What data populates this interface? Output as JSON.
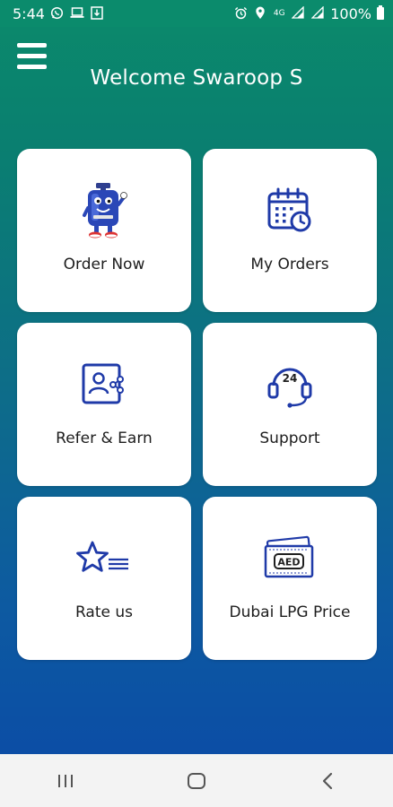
{
  "status_bar": {
    "time": "5:44",
    "left_icons": [
      "whatsapp-icon",
      "laptop-icon",
      "download-icon"
    ],
    "right_icons": [
      "alarm-icon",
      "location-icon",
      "4g-lte-icon",
      "signal-icon",
      "signal-icon"
    ],
    "network_label": "4G",
    "battery": "100%"
  },
  "header": {
    "menu_icon": "hamburger-menu-icon",
    "title": "Welcome Swaroop S"
  },
  "tiles": [
    {
      "label": "Order Now",
      "icon": "gas-cylinder-mascot-icon"
    },
    {
      "label": "My Orders",
      "icon": "calendar-clock-icon"
    },
    {
      "label": "Refer & Earn",
      "icon": "user-share-icon"
    },
    {
      "label": "Support",
      "icon": "headset-24-icon"
    },
    {
      "label": "Rate us",
      "icon": "star-rating-icon"
    },
    {
      "label": "Dubai LPG Price",
      "icon": "aed-banknote-icon"
    }
  ],
  "icon_texts": {
    "support_hours": "24",
    "currency": "AED"
  },
  "nav_bar": {
    "recents": "recents-icon",
    "home": "home-icon",
    "back": "back-icon"
  },
  "colors": {
    "gradient_top": "#0b8a6b",
    "gradient_bottom": "#0b49a7",
    "icon_blue": "#1f3aa8",
    "tile_bg": "#ffffff",
    "nav_bg": "#f3f3f3"
  }
}
